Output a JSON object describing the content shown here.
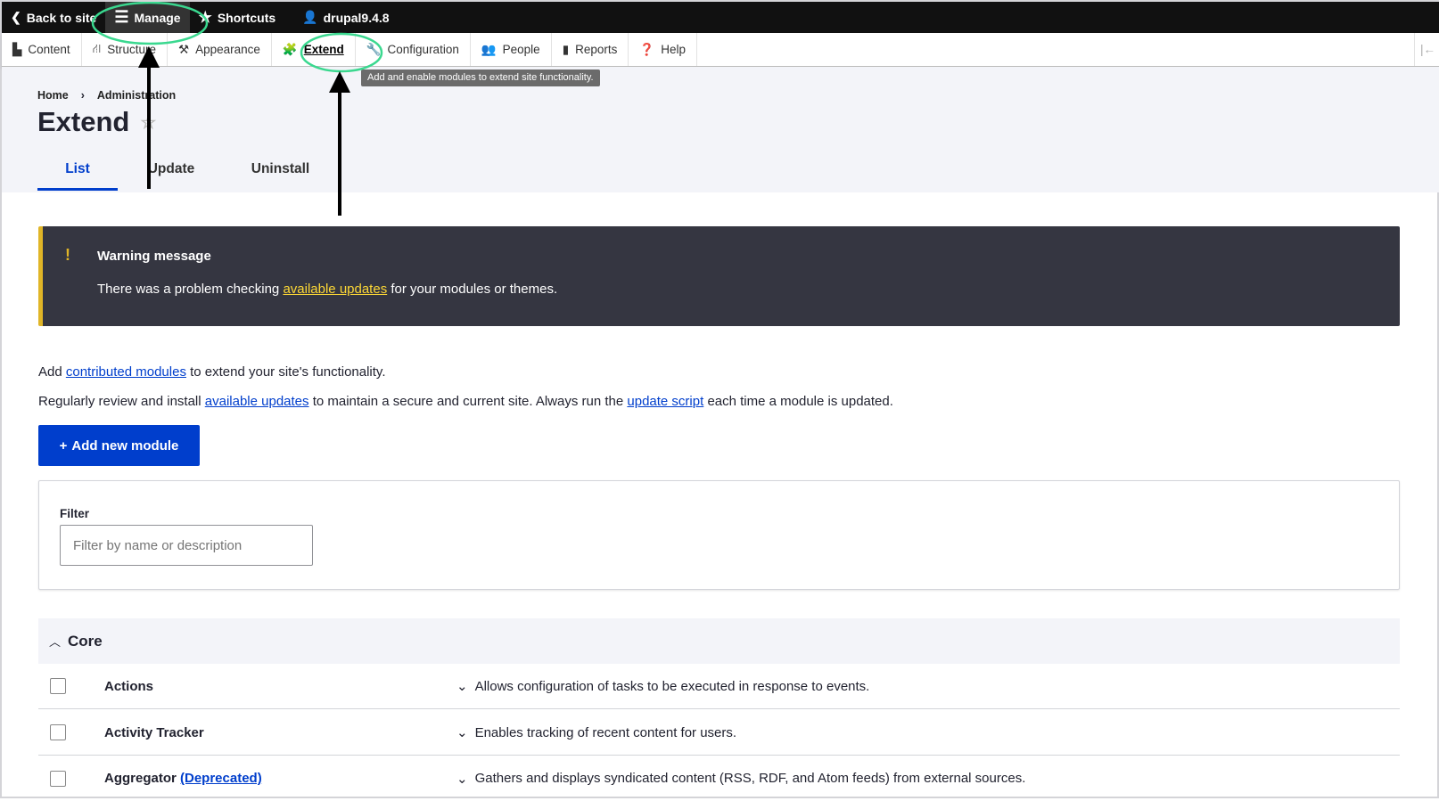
{
  "toolbar": {
    "back": "Back to site",
    "manage": "Manage",
    "shortcuts": "Shortcuts",
    "user": "drupal9.4.8"
  },
  "tray": {
    "items": [
      "Content",
      "Structure",
      "Appearance",
      "Extend",
      "Configuration",
      "People",
      "Reports",
      "Help"
    ]
  },
  "tooltip": "Add and enable modules to extend site functionality.",
  "breadcrumb": {
    "home": "Home",
    "sep": "›",
    "admin": "Administration"
  },
  "page": {
    "title": "Extend"
  },
  "tabs": [
    "List",
    "Update",
    "Uninstall"
  ],
  "warning": {
    "icon": "!",
    "title": "Warning message",
    "pre": "There was a problem checking ",
    "link": "available updates",
    "post": " for your modules or themes.",
    "accent": "#e0b527"
  },
  "intro": {
    "l1_pre": "Add ",
    "l1_link": "contributed modules",
    "l1_post": " to extend your site's functionality.",
    "l2_pre": "Regularly review and install ",
    "l2_link1": "available updates",
    "l2_mid": " to maintain a secure and current site. Always run the ",
    "l2_link2": "update script",
    "l2_post": " each time a module is updated."
  },
  "add_button": {
    "icon": "+",
    "label": "Add new module"
  },
  "filter": {
    "label": "Filter",
    "placeholder": "Filter by name or description"
  },
  "group": {
    "name": "Core"
  },
  "modules": [
    {
      "name": "Actions",
      "tag": "",
      "desc": "Allows configuration of tasks to be executed in response to events."
    },
    {
      "name": "Activity Tracker",
      "tag": "",
      "desc": "Enables tracking of recent content for users."
    },
    {
      "name": "Aggregator",
      "tag": "(Deprecated)",
      "desc": "Gathers and displays syndicated content (RSS, RDF, and Atom feeds) from external sources."
    }
  ],
  "colors": {
    "primary": "#003ecc",
    "annotation": "#3ad88f"
  }
}
